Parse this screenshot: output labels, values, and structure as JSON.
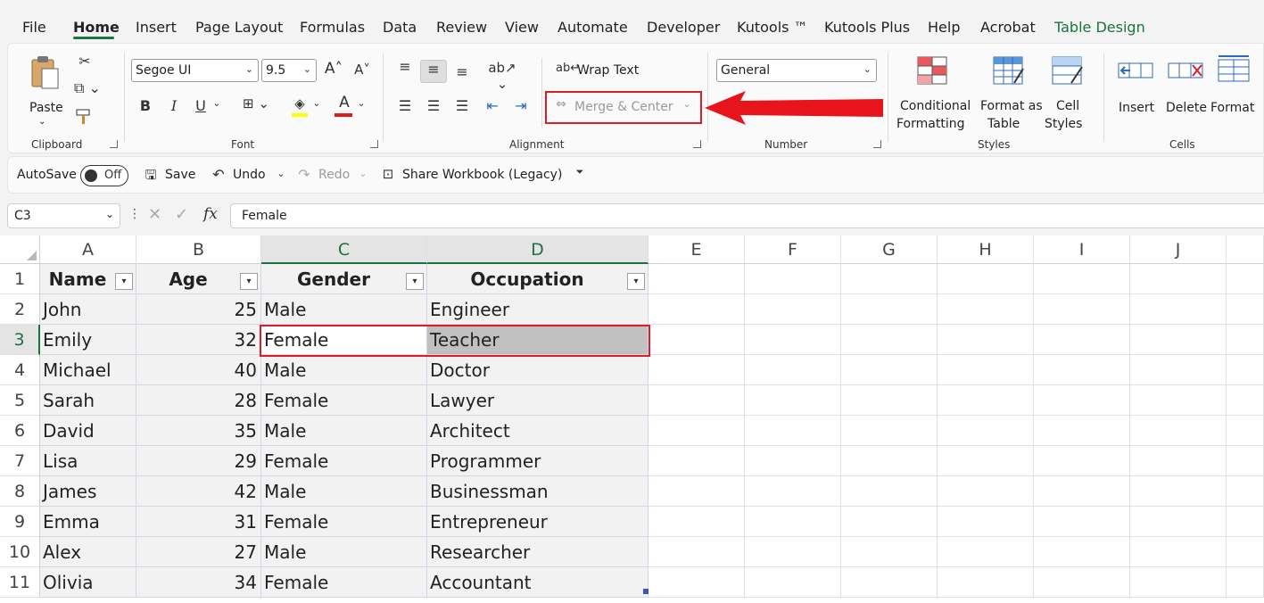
{
  "menu": {
    "items": [
      "File",
      "Home",
      "Insert",
      "Page Layout",
      "Formulas",
      "Data",
      "Review",
      "View",
      "Automate",
      "Developer",
      "Kutools ™",
      "Kutools Plus",
      "Help",
      "Acrobat",
      "Table Design"
    ]
  },
  "ribbon": {
    "clipboard": {
      "paste": "Paste",
      "label": "Clipboard"
    },
    "font": {
      "name": "Segoe UI",
      "size": "9.5",
      "bold": "B",
      "italic": "I",
      "underline": "U",
      "label": "Font"
    },
    "alignment": {
      "wrap_text": "Wrap Text",
      "merge_center": "Merge & Center",
      "label": "Alignment"
    },
    "number": {
      "format": "General",
      "label": "Number"
    },
    "styles": {
      "conditional_1": "Conditional",
      "conditional_2": "Formatting",
      "format_table_1": "Format as",
      "format_table_2": "Table",
      "cell_styles_1": "Cell",
      "cell_styles_2": "Styles",
      "label": "Styles"
    },
    "cells": {
      "insert": "Insert",
      "delete": "Delete",
      "format": "Format",
      "label": "Cells"
    }
  },
  "qat": {
    "autosave": "AutoSave",
    "toggle": "Off",
    "save": "Save",
    "undo": "Undo",
    "redo": "Redo",
    "share": "Share Workbook (Legacy)"
  },
  "formula_bar": {
    "cell_ref": "C3",
    "fx": "fx",
    "value": "Female"
  },
  "columns": [
    "A",
    "B",
    "C",
    "D",
    "E",
    "F",
    "G",
    "H",
    "I",
    "J"
  ],
  "rows": [
    "1",
    "2",
    "3",
    "4",
    "5",
    "6",
    "7",
    "8",
    "9",
    "10",
    "11"
  ],
  "table": {
    "headers": [
      "Name",
      "Age",
      "Gender",
      "Occupation"
    ],
    "rows": [
      [
        "John",
        "25",
        "Male",
        "Engineer"
      ],
      [
        "Emily",
        "32",
        "Female",
        "Teacher"
      ],
      [
        "Michael",
        "40",
        "Male",
        "Doctor"
      ],
      [
        "Sarah",
        "28",
        "Female",
        "Lawyer"
      ],
      [
        "David",
        "35",
        "Male",
        "Architect"
      ],
      [
        "Lisa",
        "29",
        "Female",
        "Programmer"
      ],
      [
        "James",
        "42",
        "Male",
        "Businessman"
      ],
      [
        "Emma",
        "31",
        "Female",
        "Entrepreneur"
      ],
      [
        "Alex",
        "27",
        "Male",
        "Researcher"
      ],
      [
        "Olivia",
        "34",
        "Female",
        "Accountant"
      ]
    ]
  },
  "colors": {
    "accent": "#1a7343",
    "highlight": "#d9202a",
    "selected_fill": "#c0c0c0"
  }
}
